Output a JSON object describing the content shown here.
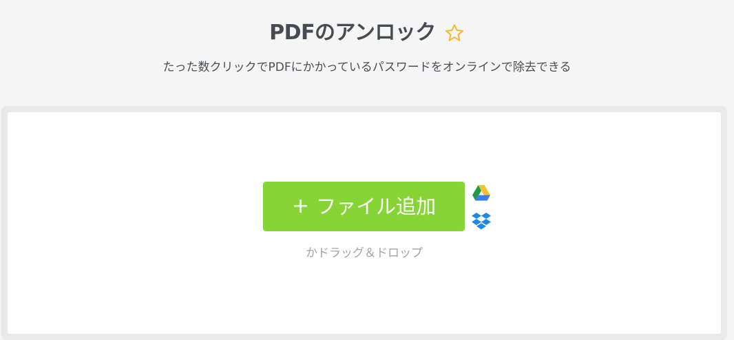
{
  "page": {
    "title": "PDFのアンロック",
    "subtitle": "たった数クリックでPDFにかかっているパスワードをオンラインで除去できる"
  },
  "upload": {
    "button_plus": "+",
    "button_label": "ファイル追加",
    "drop_hint": "かドラッグ＆ドロップ"
  },
  "icons": {
    "favorite": "star-icon",
    "google_drive": "google-drive-icon",
    "dropbox": "dropbox-icon"
  },
  "colors": {
    "accent_green": "#86d435",
    "star": "#f5b82e",
    "title_text": "#474b55"
  }
}
